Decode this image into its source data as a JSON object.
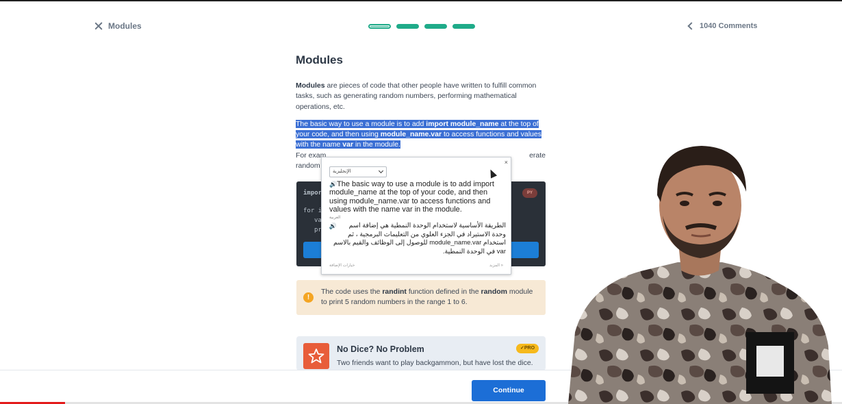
{
  "header": {
    "close_label": "Modules",
    "progress": {
      "total_steps": 4,
      "current_step": 1
    },
    "comments_label": "1040 Comments"
  },
  "lesson": {
    "title": "Modules",
    "p1_bold": "Modules",
    "p1_rest": " are pieces of code that other people have written to fulfill common tasks, such as generating random numbers, performing mathematical operations, etc.",
    "p2_a": "The basic way to use a module is to add ",
    "p2_b": "import module_name",
    "p2_c": " at the top of your code, and then using ",
    "p2_d": "module_name.var",
    "p2_e": " to access functions and values with the name ",
    "p2_f": "var",
    "p2_g": " in the module.",
    "p3_a": "For exam",
    "p3_b": "erate",
    "p3_c": "random"
  },
  "code": {
    "lines": [
      "impor",
      "for i",
      "va",
      "pr"
    ],
    "badge": "PY"
  },
  "note": {
    "text_a": "The code uses the ",
    "bold_a": "randint",
    "text_b": " function defined in the ",
    "bold_b": "random",
    "text_c": " module to print 5 random numbers in the range 1 to 6."
  },
  "card": {
    "title": "No Dice? No Problem",
    "desc": "Two friends want to play backgammon, but have lost the dice.",
    "badge": "PRO"
  },
  "footer": {
    "continue_label": "Continue"
  },
  "popup": {
    "language": "الإنجليزية",
    "source_text": "The basic way to use a module is to add import module_name at the top of your code, and then using module_name.var to access functions and values with the name var in the module.",
    "target_lang": "العربية",
    "target_text": "الطريقة الأساسية لاستخدام الوحدة النمطية هي إضافة اسم وحدة الاستيراد في الجزء العلوي من التعليمات البرمجية ، ثم استخدام module_name.var للوصول إلى الوظائف والقيم بالاسم var في الوحدة النمطية.",
    "footer_left": "خيارات الإضافة",
    "footer_right": "المزيد »",
    "close": "×"
  },
  "colors": {
    "accent_green": "#1fab89",
    "selection_blue": "#3b6fd4",
    "button_blue": "#1c6ed6",
    "note_bg": "#f7e9d5",
    "code_bg": "#2a3038"
  }
}
